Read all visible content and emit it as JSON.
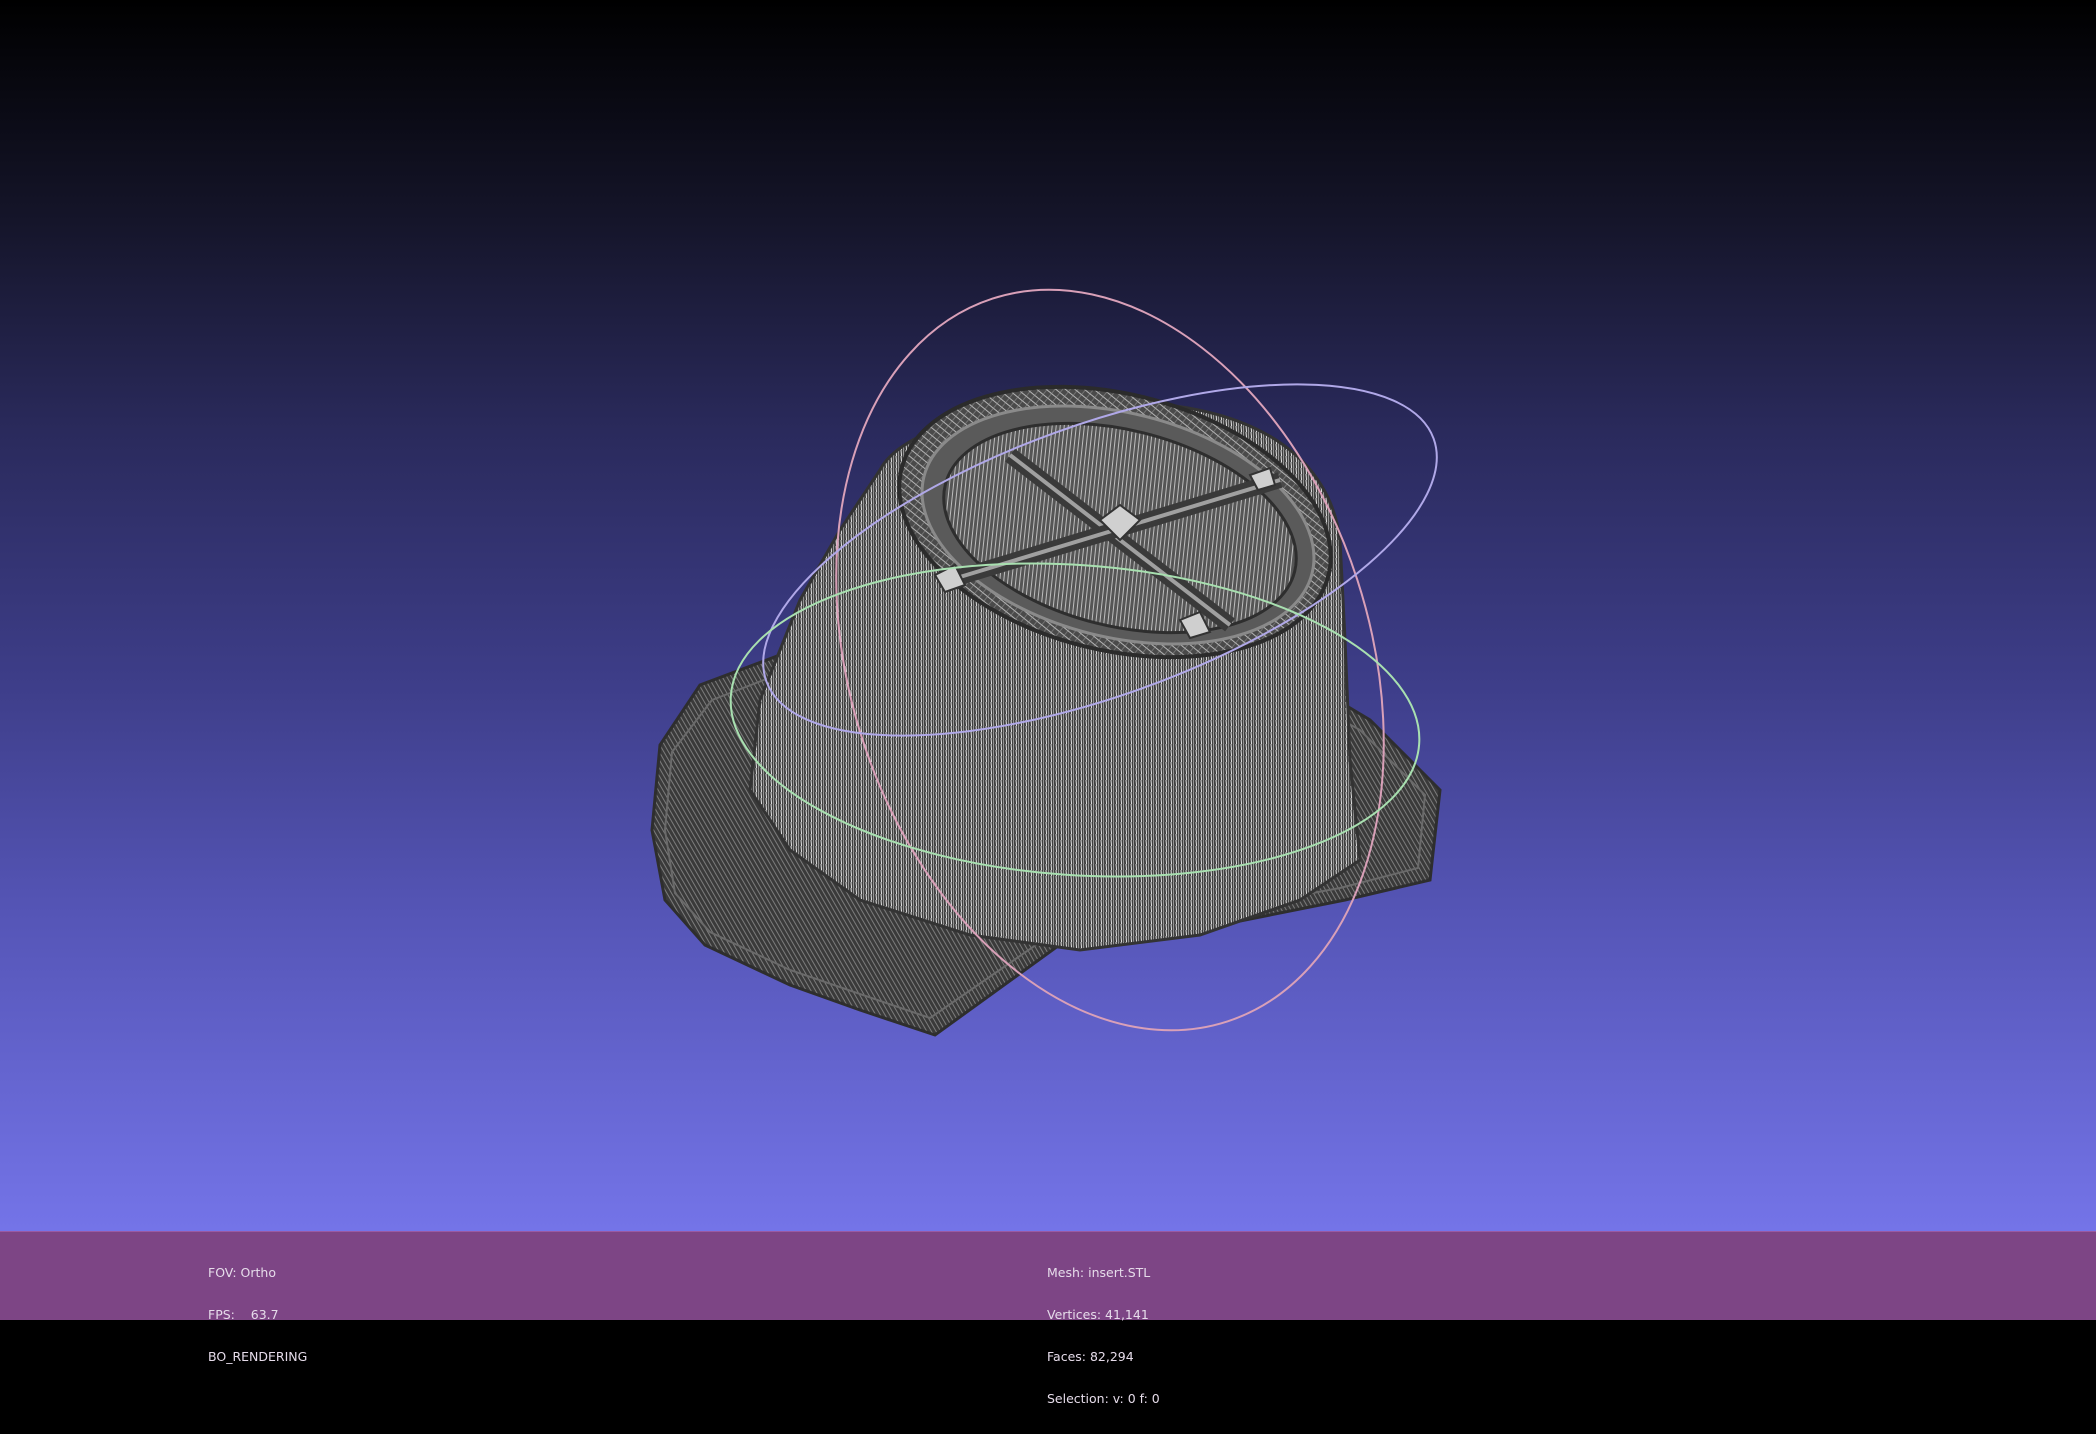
{
  "viewer": {
    "background_top": "#000000",
    "background_bottom": "#7474e8",
    "mesh_color": "#d8d8d8",
    "mesh_shadow": "#4a4a4a",
    "trackball_colors": [
      "#ff8080",
      "#80ff80",
      "#8080ff"
    ]
  },
  "status": {
    "background": "#7d4585",
    "left": {
      "fov": "FOV: Ortho",
      "fps": "FPS:    63.7",
      "mode": "BO_RENDERING"
    },
    "right": {
      "mesh": "Mesh: insert.STL",
      "vertices": "Vertices: 41,141",
      "faces": "Faces: 82,294",
      "selection": "Selection: v: 0 f: 0"
    }
  }
}
